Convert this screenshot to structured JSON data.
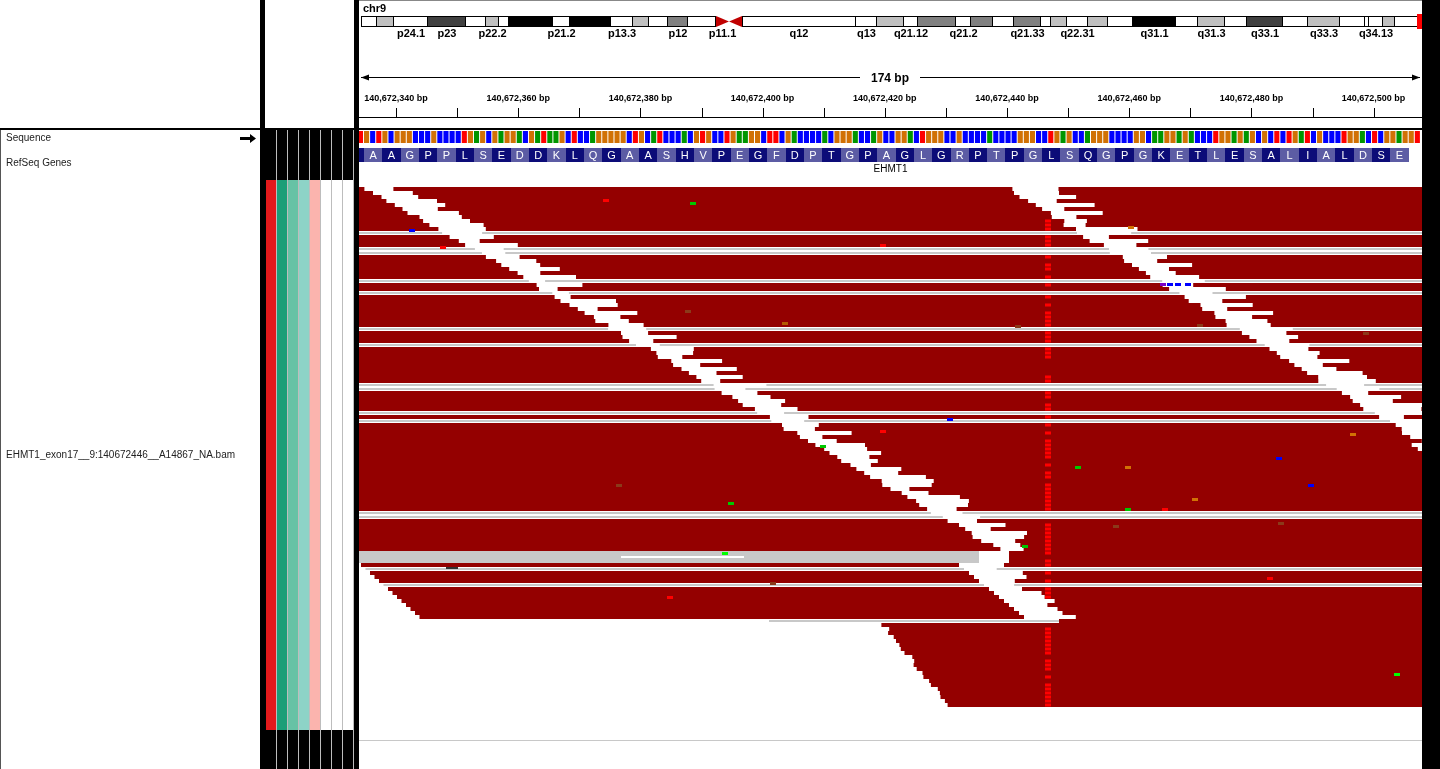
{
  "ideogram": {
    "chromosome": "chr9",
    "bands": [
      {
        "kind": "band",
        "color": "#ffffff"
      },
      {
        "kind": "band",
        "color": "#c0c0c0"
      },
      {
        "kind": "band",
        "color": "#ffffff",
        "label": "p24.1"
      },
      {
        "kind": "band",
        "color": "#404040",
        "label": "p23"
      },
      {
        "kind": "band",
        "color": "#ffffff"
      },
      {
        "kind": "band",
        "color": "#c0c0c0",
        "label": "p22.2"
      },
      {
        "kind": "band",
        "color": "#ffffff"
      },
      {
        "kind": "band",
        "color": "#000000"
      },
      {
        "kind": "band",
        "color": "#ffffff",
        "label": "p21.2"
      },
      {
        "kind": "band",
        "color": "#000000"
      },
      {
        "kind": "band",
        "color": "#ffffff",
        "label": "p13.3"
      },
      {
        "kind": "band",
        "color": "#c0c0c0"
      },
      {
        "kind": "band",
        "color": "#ffffff"
      },
      {
        "kind": "band",
        "color": "#808080",
        "label": "p12"
      },
      {
        "kind": "band",
        "color": "#ffffff"
      },
      {
        "kind": "pcen",
        "color": "#c00000",
        "label": "p11.1"
      },
      {
        "kind": "qcen",
        "color": "#c00000"
      },
      {
        "kind": "band",
        "color": "#ffffff",
        "label": "q12"
      },
      {
        "kind": "band",
        "color": "#ffffff",
        "label": "q13"
      },
      {
        "kind": "band",
        "color": "#c0c0c0"
      },
      {
        "kind": "band",
        "color": "#ffffff",
        "label": "q21.12"
      },
      {
        "kind": "band",
        "color": "#808080"
      },
      {
        "kind": "band",
        "color": "#ffffff",
        "label": "q21.2"
      },
      {
        "kind": "band",
        "color": "#808080"
      },
      {
        "kind": "band",
        "color": "#ffffff"
      },
      {
        "kind": "band",
        "color": "#808080",
        "label": "q21.33"
      },
      {
        "kind": "band",
        "color": "#ffffff"
      },
      {
        "kind": "band",
        "color": "#c0c0c0"
      },
      {
        "kind": "band",
        "color": "#ffffff",
        "label": "q22.31"
      },
      {
        "kind": "band",
        "color": "#c0c0c0"
      },
      {
        "kind": "band",
        "color": "#ffffff"
      },
      {
        "kind": "band",
        "color": "#000000",
        "label": "q31.1"
      },
      {
        "kind": "band",
        "color": "#ffffff"
      },
      {
        "kind": "band",
        "color": "#c0c0c0",
        "label": "q31.3"
      },
      {
        "kind": "band",
        "color": "#ffffff"
      },
      {
        "kind": "band",
        "color": "#404040",
        "label": "q33.1"
      },
      {
        "kind": "band",
        "color": "#ffffff"
      },
      {
        "kind": "band",
        "color": "#c0c0c0",
        "label": "q33.3"
      },
      {
        "kind": "band",
        "color": "#ffffff"
      },
      {
        "kind": "band",
        "color": "#ffffff"
      },
      {
        "kind": "band",
        "color": "#ffffff",
        "label": "q34.13"
      },
      {
        "kind": "band",
        "color": "#c0c0c0"
      },
      {
        "kind": "band",
        "color": "#ffffff"
      }
    ]
  },
  "ruler": {
    "span": "174 bp",
    "ticks": [
      "140,672,340 bp",
      "140,672,360 bp",
      "140,672,380 bp",
      "140,672,400 bp",
      "140,672,420 bp",
      "140,672,440 bp",
      "140,672,460 bp",
      "140,672,480 bp",
      "140,672,500 bp"
    ]
  },
  "tracks": [
    {
      "kind": "sequence",
      "name": "Sequence",
      "forward": true,
      "bases": [
        {
          "color": "#ff0000"
        },
        {
          "color": "#d17105"
        },
        {
          "color": "#0000ff"
        },
        {
          "color": "#ff0000"
        },
        {
          "color": "#d17105"
        },
        {
          "color": "#0000ff"
        },
        {
          "color": "#d17105"
        },
        {
          "color": "#d17105"
        },
        {
          "color": "#d17105"
        },
        {
          "color": "#0000ff"
        },
        {
          "color": "#0000ff"
        },
        {
          "color": "#0000ff"
        },
        {
          "color": "#d17105"
        },
        {
          "color": "#0000ff"
        },
        {
          "color": "#0000ff"
        },
        {
          "color": "#0000ff"
        },
        {
          "color": "#0000ff"
        },
        {
          "color": "#ff0000"
        },
        {
          "color": "#d17105"
        },
        {
          "color": "#009600"
        },
        {
          "color": "#d17105"
        },
        {
          "color": "#0000ff"
        },
        {
          "color": "#d17105"
        },
        {
          "color": "#009600"
        },
        {
          "color": "#d17105"
        },
        {
          "color": "#d17105"
        },
        {
          "color": "#009600"
        },
        {
          "color": "#0000ff"
        },
        {
          "color": "#d17105"
        },
        {
          "color": "#009600"
        },
        {
          "color": "#ff0000"
        },
        {
          "color": "#009600"
        },
        {
          "color": "#009600"
        },
        {
          "color": "#d17105"
        },
        {
          "color": "#0000ff"
        },
        {
          "color": "#ff0000"
        },
        {
          "color": "#0000ff"
        },
        {
          "color": "#0000ff"
        },
        {
          "color": "#009600"
        },
        {
          "color": "#d17105"
        },
        {
          "color": "#d17105"
        },
        {
          "color": "#d17105"
        },
        {
          "color": "#d17105"
        },
        {
          "color": "#d17105"
        },
        {
          "color": "#0000ff"
        },
        {
          "color": "#ff0000"
        },
        {
          "color": "#d17105"
        },
        {
          "color": "#0000ff"
        },
        {
          "color": "#009600"
        },
        {
          "color": "#ff0000"
        },
        {
          "color": "#0000ff"
        },
        {
          "color": "#0000ff"
        },
        {
          "color": "#0000ff"
        },
        {
          "color": "#009600"
        },
        {
          "color": "#0000ff"
        },
        {
          "color": "#d17105"
        },
        {
          "color": "#ff0000"
        },
        {
          "color": "#d17105"
        },
        {
          "color": "#0000ff"
        },
        {
          "color": "#0000ff"
        },
        {
          "color": "#ff0000"
        },
        {
          "color": "#d17105"
        },
        {
          "color": "#009600"
        },
        {
          "color": "#009600"
        },
        {
          "color": "#d17105"
        },
        {
          "color": "#d17105"
        },
        {
          "color": "#0000ff"
        },
        {
          "color": "#ff0000"
        },
        {
          "color": "#ff0000"
        },
        {
          "color": "#0000ff"
        },
        {
          "color": "#d17105"
        },
        {
          "color": "#009600"
        },
        {
          "color": "#0000ff"
        },
        {
          "color": "#0000ff"
        },
        {
          "color": "#0000ff"
        },
        {
          "color": "#0000ff"
        },
        {
          "color": "#009600"
        },
        {
          "color": "#0000ff"
        },
        {
          "color": "#d17105"
        },
        {
          "color": "#d17105"
        },
        {
          "color": "#d17105"
        },
        {
          "color": "#009600"
        },
        {
          "color": "#0000ff"
        },
        {
          "color": "#0000ff"
        },
        {
          "color": "#009600"
        },
        {
          "color": "#d17105"
        },
        {
          "color": "#0000ff"
        },
        {
          "color": "#0000ff"
        },
        {
          "color": "#d17105"
        },
        {
          "color": "#d17105"
        },
        {
          "color": "#009600"
        },
        {
          "color": "#0000ff"
        },
        {
          "color": "#ff0000"
        },
        {
          "color": "#d17105"
        },
        {
          "color": "#d17105"
        },
        {
          "color": "#d17105"
        },
        {
          "color": "#0000ff"
        },
        {
          "color": "#0000ff"
        },
        {
          "color": "#d17105"
        },
        {
          "color": "#0000ff"
        },
        {
          "color": "#0000ff"
        },
        {
          "color": "#0000ff"
        },
        {
          "color": "#0000ff"
        },
        {
          "color": "#009600"
        },
        {
          "color": "#0000ff"
        },
        {
          "color": "#0000ff"
        },
        {
          "color": "#0000ff"
        },
        {
          "color": "#0000ff"
        },
        {
          "color": "#d17105"
        },
        {
          "color": "#d17105"
        },
        {
          "color": "#d17105"
        },
        {
          "color": "#0000ff"
        },
        {
          "color": "#0000ff"
        },
        {
          "color": "#ff0000"
        },
        {
          "color": "#d17105"
        },
        {
          "color": "#009600"
        },
        {
          "color": "#d17105"
        },
        {
          "color": "#0000ff"
        },
        {
          "color": "#0000ff"
        },
        {
          "color": "#009600"
        },
        {
          "color": "#d17105"
        },
        {
          "color": "#d17105"
        },
        {
          "color": "#d17105"
        },
        {
          "color": "#0000ff"
        },
        {
          "color": "#0000ff"
        },
        {
          "color": "#0000ff"
        },
        {
          "color": "#0000ff"
        },
        {
          "color": "#d17105"
        },
        {
          "color": "#d17105"
        },
        {
          "color": "#0000ff"
        },
        {
          "color": "#009600"
        },
        {
          "color": "#009600"
        },
        {
          "color": "#d17105"
        },
        {
          "color": "#d17105"
        },
        {
          "color": "#009600"
        },
        {
          "color": "#d17105"
        },
        {
          "color": "#009600"
        },
        {
          "color": "#0000ff"
        },
        {
          "color": "#0000ff"
        },
        {
          "color": "#0000ff"
        },
        {
          "color": "#ff0000"
        },
        {
          "color": "#d17105"
        },
        {
          "color": "#d17105"
        },
        {
          "color": "#009600"
        },
        {
          "color": "#d17105"
        },
        {
          "color": "#009600"
        },
        {
          "color": "#d17105"
        },
        {
          "color": "#0000ff"
        },
        {
          "color": "#d17105"
        },
        {
          "color": "#0000ff"
        },
        {
          "color": "#ff0000"
        },
        {
          "color": "#0000ff"
        },
        {
          "color": "#ff0000"
        },
        {
          "color": "#d17105"
        },
        {
          "color": "#009600"
        },
        {
          "color": "#ff0000"
        },
        {
          "color": "#0000ff"
        },
        {
          "color": "#d17105"
        },
        {
          "color": "#0000ff"
        },
        {
          "color": "#0000ff"
        },
        {
          "color": "#0000ff"
        },
        {
          "color": "#ff0000"
        },
        {
          "color": "#d17105"
        },
        {
          "color": "#d17105"
        },
        {
          "color": "#009600"
        },
        {
          "color": "#0000ff"
        },
        {
          "color": "#ff0000"
        },
        {
          "color": "#0000ff"
        },
        {
          "color": "#d17105"
        },
        {
          "color": "#d17105"
        },
        {
          "color": "#009600"
        },
        {
          "color": "#d17105"
        },
        {
          "color": "#d17105"
        },
        {
          "color": "#ff0000"
        }
      ]
    },
    {
      "kind": "gene",
      "name": "RefSeq Genes",
      "gene": "EHMT1",
      "leading_partial": true,
      "amino_acids": [
        "A",
        "A",
        "G",
        "P",
        "P",
        "L",
        "S",
        "E",
        "D",
        "D",
        "K",
        "L",
        "Q",
        "G",
        "A",
        "A",
        "S",
        "H",
        "V",
        "P",
        "E",
        "G",
        "F",
        "D",
        "P",
        "T",
        "G",
        "P",
        "A",
        "G",
        "L",
        "G",
        "R",
        "P",
        "T",
        "P",
        "G",
        "L",
        "S",
        "Q",
        "G",
        "P",
        "G",
        "K",
        "E",
        "T",
        "L",
        "E",
        "S",
        "A",
        "L",
        "I",
        "A",
        "L",
        "D",
        "S",
        "E"
      ]
    },
    {
      "kind": "alignment",
      "name": "EHMT1_exon17__9:140672446__A14867_NA.bam",
      "attributes": [
        {
          "color": "#e31a1c"
        },
        {
          "color": "#1b9e77"
        },
        {
          "color": "#66c2a5"
        },
        {
          "color": "#8dd3c7"
        },
        {
          "color": "#fbb4ae"
        },
        {
          "color": "#ffffff"
        },
        {
          "color": "#ffffff"
        },
        {
          "color": "#ffffff"
        }
      ]
    }
  ]
}
